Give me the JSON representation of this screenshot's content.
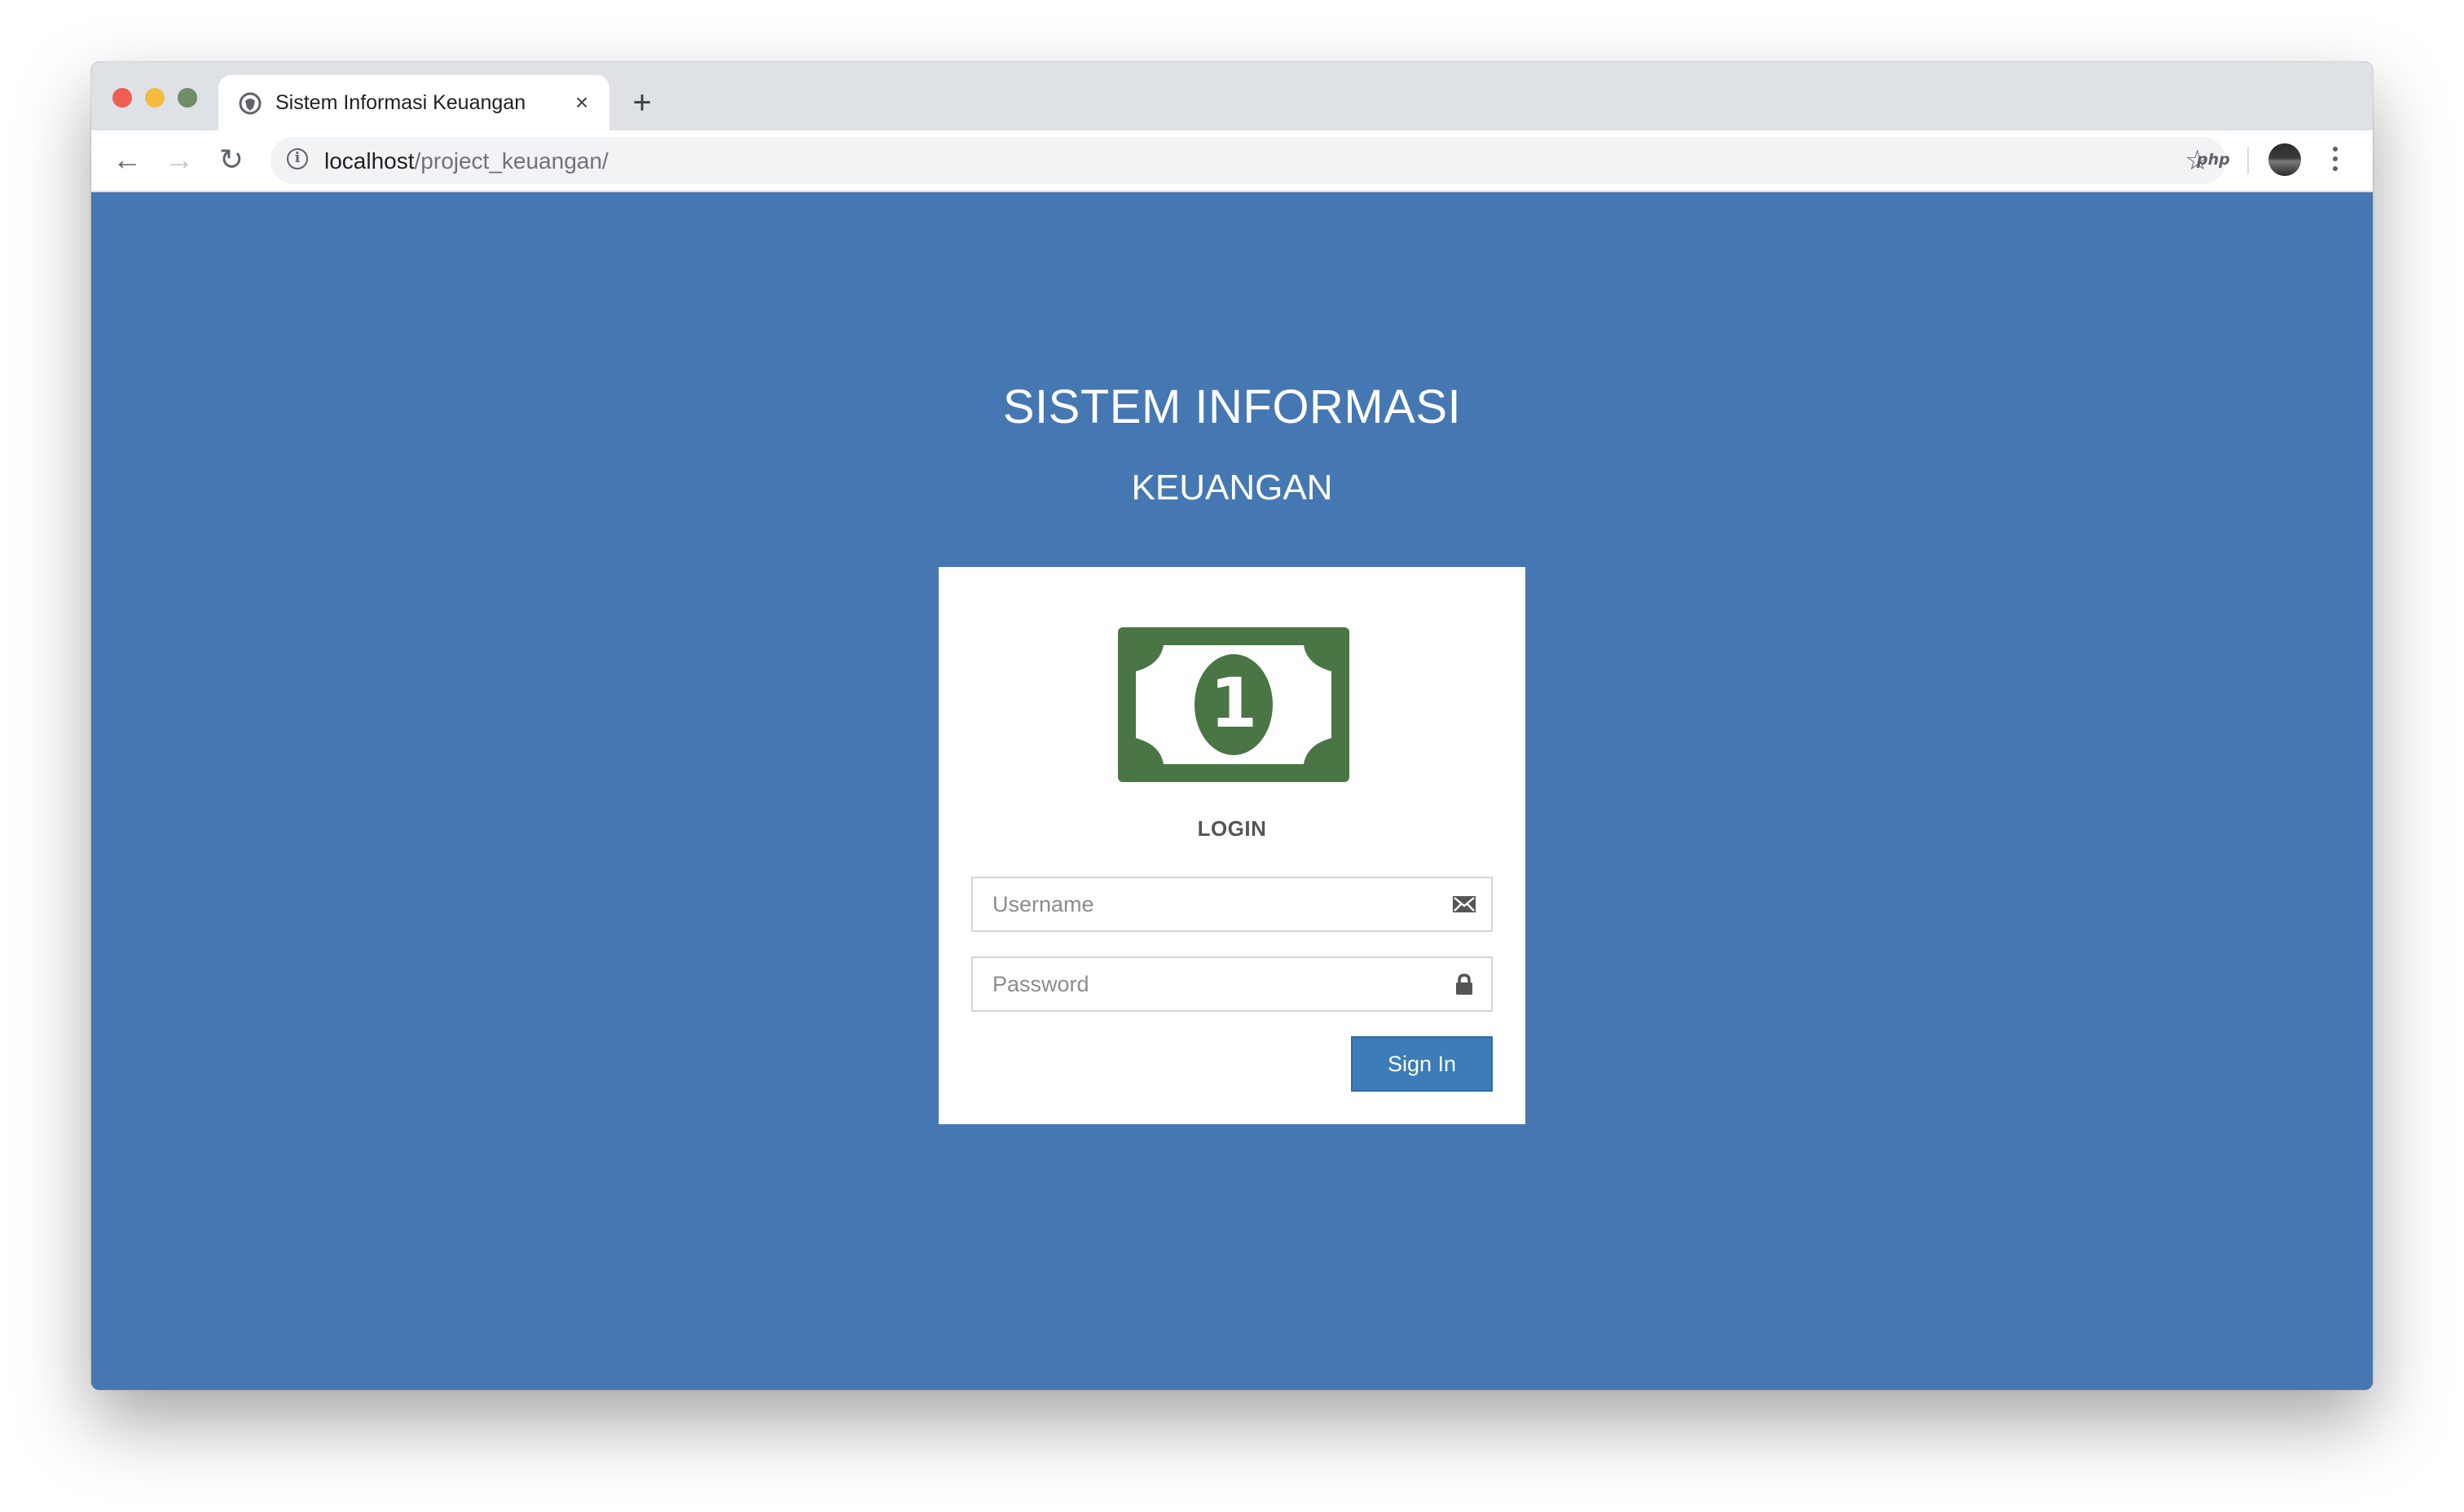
{
  "browser": {
    "tab": {
      "title": "Sistem Informasi Keuangan",
      "close_glyph": "×",
      "favicon": "globe-icon"
    },
    "new_tab_glyph": "+",
    "nav": {
      "back_glyph": "←",
      "forward_glyph": "→",
      "reload_glyph": "↻"
    },
    "address": {
      "host": "localhost",
      "path": "/project_keuangan/",
      "info_glyph": "i"
    },
    "star_glyph": "☆",
    "extension_label": "php"
  },
  "page": {
    "background_color": "#4578b2",
    "title_line1": "SISTEM INFORMASI",
    "title_line2": "KEUANGAN",
    "login": {
      "logo_icon": "money-bill-icon",
      "logo_digit": "1",
      "logo_color": "#4a7545",
      "heading": "LOGIN",
      "username_placeholder": "Username",
      "password_placeholder": "Password",
      "username_icon": "envelope-icon",
      "password_icon": "lock-icon",
      "submit_label": "Sign In",
      "submit_color": "#3c7cb9"
    }
  }
}
